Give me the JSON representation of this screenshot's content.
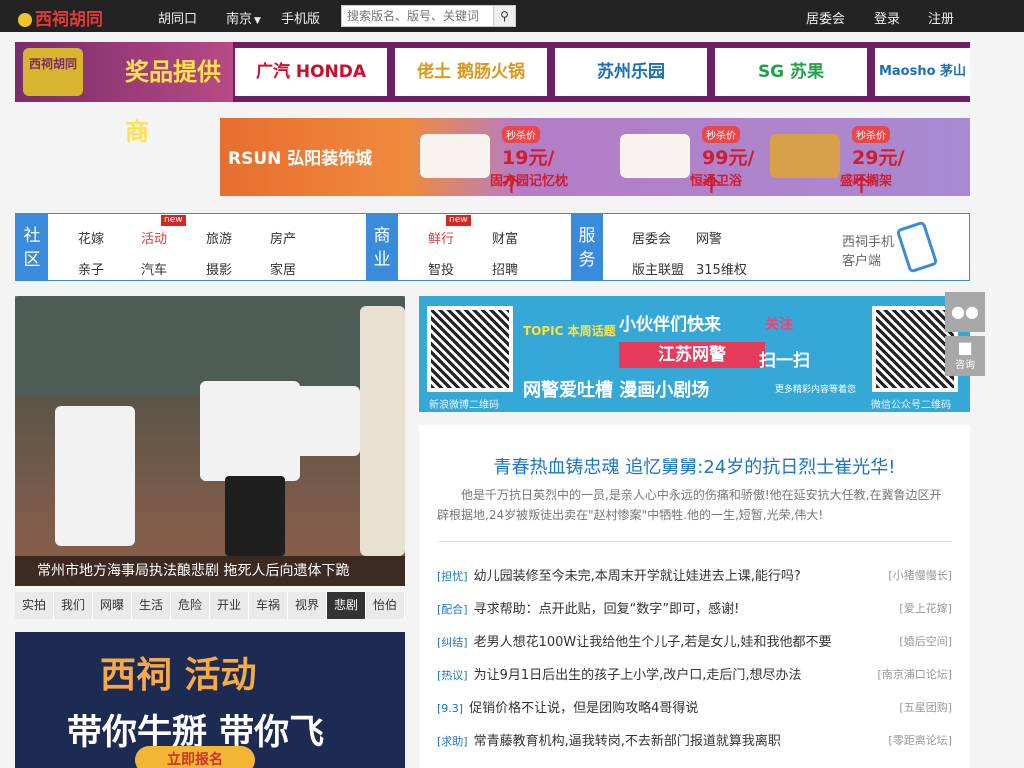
{
  "header": {
    "logo": "西祠胡同",
    "nav_home": "胡同口",
    "city": "南京",
    "mobile": "手机版",
    "search_placeholder": "搜索版名、版号、关键词",
    "juweihui": "居委会",
    "login": "登录",
    "register": "注册"
  },
  "ad_strip": {
    "lead": "奖品提供商",
    "badge": "西祠胡同",
    "sponsors": [
      "广汽 HONDA",
      "佬土 鹅肠火锅",
      "苏州乐园",
      "SG 苏果",
      "Maosho 茅山"
    ]
  },
  "banner2": {
    "brand": "RSUN 弘阳装饰城",
    "deals": [
      {
        "tag": "秒杀价",
        "price": "19元/个",
        "name": "固方园记忆枕"
      },
      {
        "tag": "秒杀价",
        "price": "99元/个",
        "name": "恒通卫浴"
      },
      {
        "tag": "秒杀价",
        "price": "29元/个",
        "name": "盛旺搁架"
      }
    ]
  },
  "menu": {
    "community": "社区",
    "business": "商业",
    "service": "服务",
    "community_items": [
      "花嫁",
      "活动",
      "旅游",
      "房产",
      "亲子",
      "汽车",
      "摄影",
      "家居"
    ],
    "business_items": [
      "鲜行",
      "财富",
      "智投",
      "招聘"
    ],
    "service_items": [
      "居委会",
      "网警",
      "版主联盟",
      "315维权"
    ],
    "new_badge": "new",
    "mobile_client": "西祠手机客户端"
  },
  "hero": {
    "caption": "常州市地方海事局执法酿悲剧 拖死人后向遗体下跪"
  },
  "categories": [
    "实拍",
    "我们",
    "网曝",
    "生活",
    "危险",
    "开业",
    "车祸",
    "视界",
    "悲剧",
    "怡伯"
  ],
  "promo": {
    "line1": "西祠 活动",
    "line2": "带你牛掰 带你飞",
    "button": "立即报名"
  },
  "police_ad": {
    "topic": "TOPIC 本周话题",
    "line1": "小伙伴们快来",
    "focus": "关注",
    "line2": "江苏网警",
    "scan": "扫一扫",
    "line3": "网警爱吐槽 漫画小剧场",
    "note": "更多精彩内容等着您",
    "qr_left_caption": "新浪微博二维码",
    "qr_right_caption": "微信公众号二维码"
  },
  "article": {
    "headline": "青春热血铸忠魂 追忆舅舅:24岁的抗日烈士崔光华!",
    "summary": "他是千万抗日英烈中的一员,是亲人心中永远的伤痛和骄傲!他在延安抗大任教,在冀鲁边区开辟根据地,24岁被叛徒出卖在\"赵村惨案\"中牺牲.他的一生,短暂,光荣,伟大!",
    "items": [
      {
        "tag": "[担忧]",
        "title": "幼儿园装修至今未完,本周末开学就让娃进去上课,能行吗?",
        "src": "[小猪慢慢长]"
      },
      {
        "tag": "[配合]",
        "title": "寻求帮助：点开此贴，回复“数字”即可，感谢!",
        "src": "[爱上花嫁]"
      },
      {
        "tag": "[纠结]",
        "title": "老男人想花100W让我给他生个儿子,若是女儿,娃和我他都不要",
        "src": "[婚后空间]"
      },
      {
        "tag": "[热议]",
        "title": "为让9月1日后出生的孩子上小学,改户口,走后门,想尽办法",
        "src": "[南京浦口论坛]"
      },
      {
        "tag": "[9.3]",
        "title": "促销价格不让说，但是团购攻略4哥得说",
        "src": "[五星团购]"
      },
      {
        "tag": "[求助]",
        "title": "常青藤教育机构,逼我转岗,不去新部门报道就算我离职",
        "src": "[零距离论坛]"
      }
    ]
  },
  "side": {
    "wechat": "微信",
    "consult": "咨询"
  }
}
